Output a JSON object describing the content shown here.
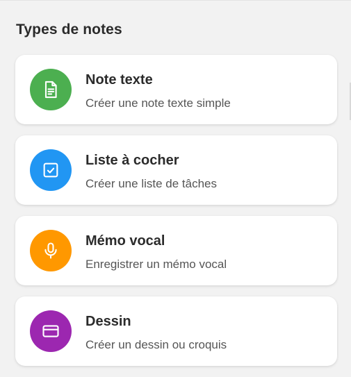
{
  "section": {
    "title": "Types de notes"
  },
  "cards": [
    {
      "title": "Note texte",
      "subtitle": "Créer une note texte simple",
      "icon": "document-icon",
      "color": "#4caf50"
    },
    {
      "title": "Liste à cocher",
      "subtitle": "Créer une liste de tâches",
      "icon": "checkbox-icon",
      "color": "#2196f3"
    },
    {
      "title": "Mémo vocal",
      "subtitle": "Enregistrer un mémo vocal",
      "icon": "microphone-icon",
      "color": "#ff9800"
    },
    {
      "title": "Dessin",
      "subtitle": "Créer un dessin ou croquis",
      "icon": "drawing-card-icon",
      "color": "#9c27b0"
    }
  ]
}
